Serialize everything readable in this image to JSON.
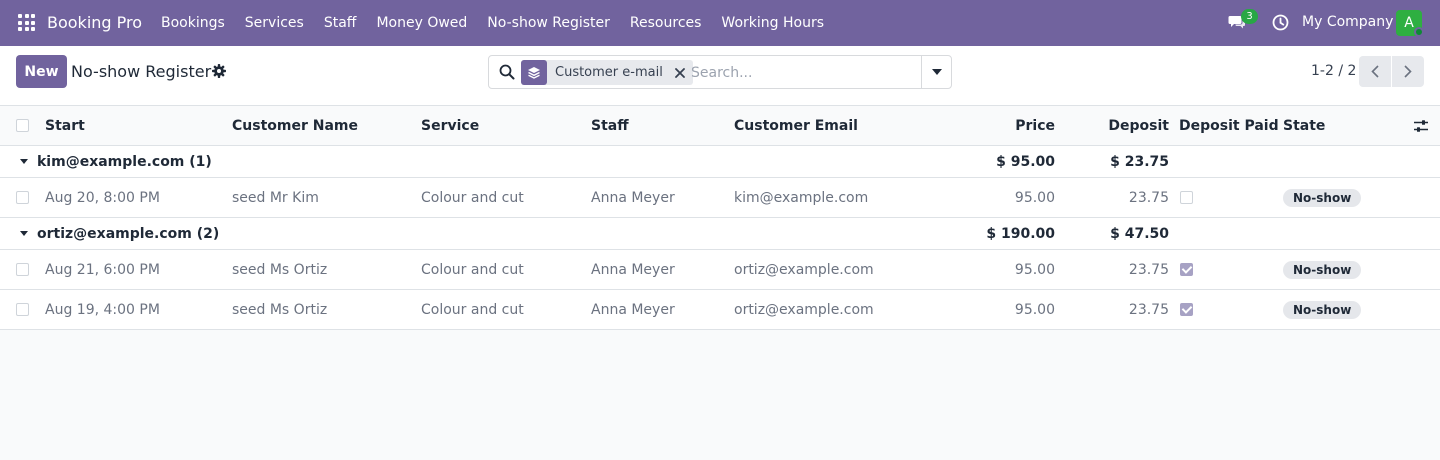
{
  "navbar": {
    "brand": "Booking Pro",
    "menu": [
      "Bookings",
      "Services",
      "Staff",
      "Money Owed",
      "No-show Register",
      "Resources",
      "Working Hours"
    ],
    "message_count": "3",
    "company": "My Company",
    "avatar_letter": "A"
  },
  "control": {
    "new_label": "New",
    "title": "No-show Register",
    "facet_label": "Customer e-mail",
    "search_placeholder": "Search...",
    "pager": "1-2 / 2"
  },
  "list": {
    "columns": {
      "start": "Start",
      "customer_name": "Customer Name",
      "service": "Service",
      "staff": "Staff",
      "customer_email": "Customer Email",
      "price": "Price",
      "deposit": "Deposit",
      "deposit_paid": "Deposit Paid",
      "state": "State"
    },
    "groups": [
      {
        "label": "kim@example.com (1)",
        "price_total": "$ 95.00",
        "deposit_total": "$ 23.75",
        "rows": [
          {
            "start": "Aug 20, 8:00 PM",
            "customer_name": "seed Mr Kim",
            "service": "Colour and cut",
            "staff": "Anna Meyer",
            "customer_email": "kim@example.com",
            "price": "95.00",
            "deposit": "23.75",
            "deposit_paid": false,
            "state": "No-show"
          }
        ]
      },
      {
        "label": "ortiz@example.com (2)",
        "price_total": "$ 190.00",
        "deposit_total": "$ 47.50",
        "rows": [
          {
            "start": "Aug 21, 6:00 PM",
            "customer_name": "seed Ms Ortiz",
            "service": "Colour and cut",
            "staff": "Anna Meyer",
            "customer_email": "ortiz@example.com",
            "price": "95.00",
            "deposit": "23.75",
            "deposit_paid": true,
            "state": "No-show"
          },
          {
            "start": "Aug 19, 4:00 PM",
            "customer_name": "seed Ms Ortiz",
            "service": "Colour and cut",
            "staff": "Anna Meyer",
            "customer_email": "ortiz@example.com",
            "price": "95.00",
            "deposit": "23.75",
            "deposit_paid": true,
            "state": "No-show"
          }
        ]
      }
    ]
  },
  "colors": {
    "brand": "#71639e",
    "badge_bg": "#e5e7eb",
    "online": "#28a745"
  }
}
